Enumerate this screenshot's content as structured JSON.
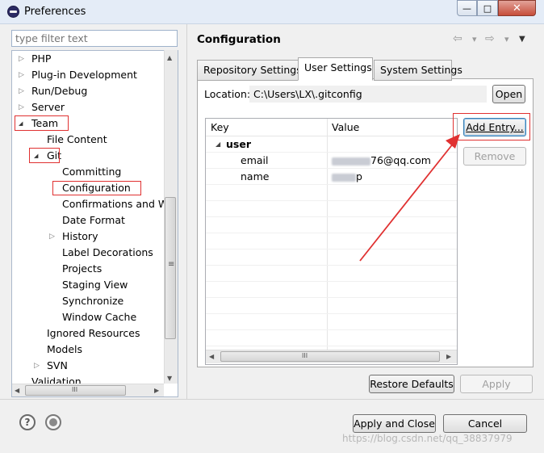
{
  "window": {
    "title": "Preferences",
    "min_symbol": "—",
    "max_symbol": "□",
    "close_symbol": "✕"
  },
  "left": {
    "filter_placeholder": "type filter text",
    "tree": [
      {
        "label": "PHP",
        "twisty": "▷"
      },
      {
        "label": "Plug-in Development",
        "twisty": "▷"
      },
      {
        "label": "Run/Debug",
        "twisty": "▷"
      },
      {
        "label": "Server",
        "twisty": "▷"
      },
      {
        "label": "Team",
        "twisty": "◢"
      },
      {
        "label": "File Content",
        "twisty": ""
      },
      {
        "label": "Git",
        "twisty": "◢"
      },
      {
        "label": "Committing",
        "twisty": ""
      },
      {
        "label": "Configuration",
        "twisty": ""
      },
      {
        "label": "Confirmations and Warnings",
        "twisty": ""
      },
      {
        "label": "Date Format",
        "twisty": ""
      },
      {
        "label": "History",
        "twisty": "▷"
      },
      {
        "label": "Label Decorations",
        "twisty": ""
      },
      {
        "label": "Projects",
        "twisty": ""
      },
      {
        "label": "Staging View",
        "twisty": ""
      },
      {
        "label": "Synchronize",
        "twisty": ""
      },
      {
        "label": "Window Cache",
        "twisty": ""
      },
      {
        "label": "Ignored Resources",
        "twisty": ""
      },
      {
        "label": "Models",
        "twisty": ""
      },
      {
        "label": "SVN",
        "twisty": "▷"
      },
      {
        "label": "Validation",
        "twisty": ""
      }
    ],
    "scroll_up": "▲",
    "scroll_down": "▼",
    "scroll_left": "◀",
    "scroll_right": "▶",
    "grip": "≡",
    "hgrip": "III"
  },
  "right": {
    "title": "Configuration",
    "nav_back": "⇦",
    "nav_forward": "⇨",
    "nav_drop": "▾",
    "menu": "▼",
    "tabs": [
      {
        "label": "Repository Settings",
        "active": false
      },
      {
        "label": "User Settings",
        "active": true
      },
      {
        "label": "System Settings",
        "active": false
      }
    ],
    "location_label": "Location:",
    "location_value": "C:\\Users\\LX\\.gitconfig",
    "open_button": "Open",
    "table": {
      "headers": [
        "Key",
        "Value"
      ],
      "rows": [
        {
          "key": "user",
          "value": "",
          "expand": "◢",
          "bold": true
        },
        {
          "key": "email",
          "value": "76@qq.com",
          "value_blur_prefix": true
        },
        {
          "key": "name",
          "value": "p",
          "value_blur_prefix": true
        }
      ],
      "scroll_left": "◀",
      "scroll_right": "▶",
      "grip": "III"
    },
    "add_entry_button": "Add Entry...",
    "remove_button": "Remove",
    "restore_defaults_button": "Restore Defaults",
    "apply_button": "Apply"
  },
  "footer": {
    "help_icon": "?",
    "apply_close_button": "Apply and Close",
    "cancel_button": "Cancel",
    "watermark": "https://blog.csdn.net/qq_38837979"
  },
  "colors": {
    "highlight": "#e03131",
    "accent": "#3c7fb1"
  }
}
